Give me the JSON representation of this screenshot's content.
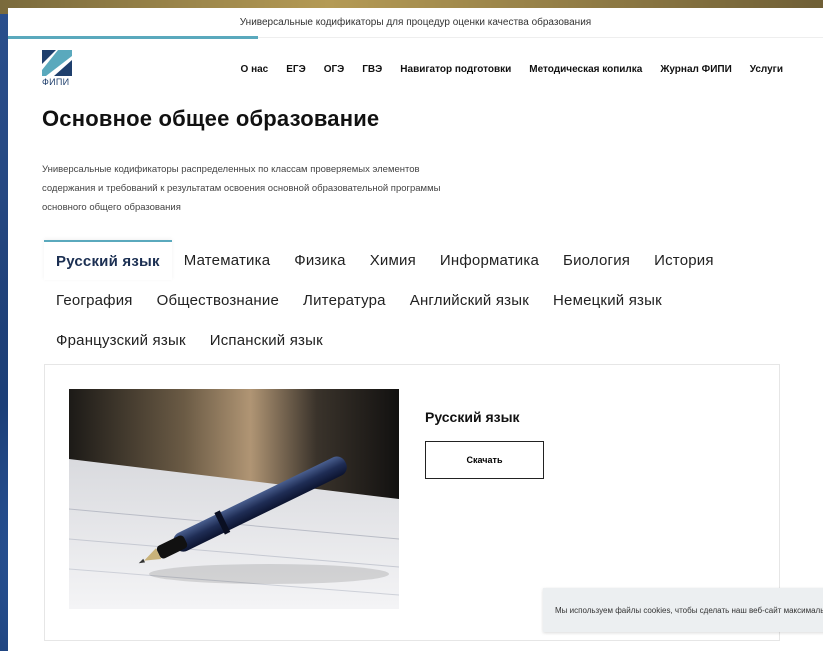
{
  "topbar": {
    "text": "Универсальные кодификаторы для процедур оценки качества образования"
  },
  "logo": {
    "text": "ФИПИ"
  },
  "nav": [
    "О нас",
    "ЕГЭ",
    "ОГЭ",
    "ГВЭ",
    "Навигатор подготовки",
    "Методическая копилка",
    "Журнал ФИПИ",
    "Услуги"
  ],
  "page": {
    "title": "Основное общее образование",
    "description_lines": [
      "Универсальные кодификаторы распределенных по классам проверяемых элементов",
      "содержания и требований к результатам освоения основной образовательной программы",
      "основного общего образования"
    ]
  },
  "tabs": {
    "row1": [
      "Русский язык",
      "Математика",
      "Физика",
      "Химия",
      "Информатика",
      "Биология",
      "История"
    ],
    "row2": [
      "География",
      "Обществознание",
      "Литература",
      "Английский язык",
      "Немецкий язык"
    ],
    "row3": [
      "Французский язык",
      "Испанский язык"
    ],
    "active": "Русский язык"
  },
  "card": {
    "title": "Русский язык",
    "download_label": "Скачать"
  },
  "cookie": {
    "text": "Мы используем файлы cookies, чтобы сделать наш веб-сайт максимально"
  },
  "colors": {
    "accent": "#5aa9bd",
    "logo_blue": "#1f3f6d",
    "logo_teal": "#5aa9bd"
  },
  "icons": {
    "logo": "fipi-logo-icon",
    "photo": "pen-on-paper-image"
  }
}
